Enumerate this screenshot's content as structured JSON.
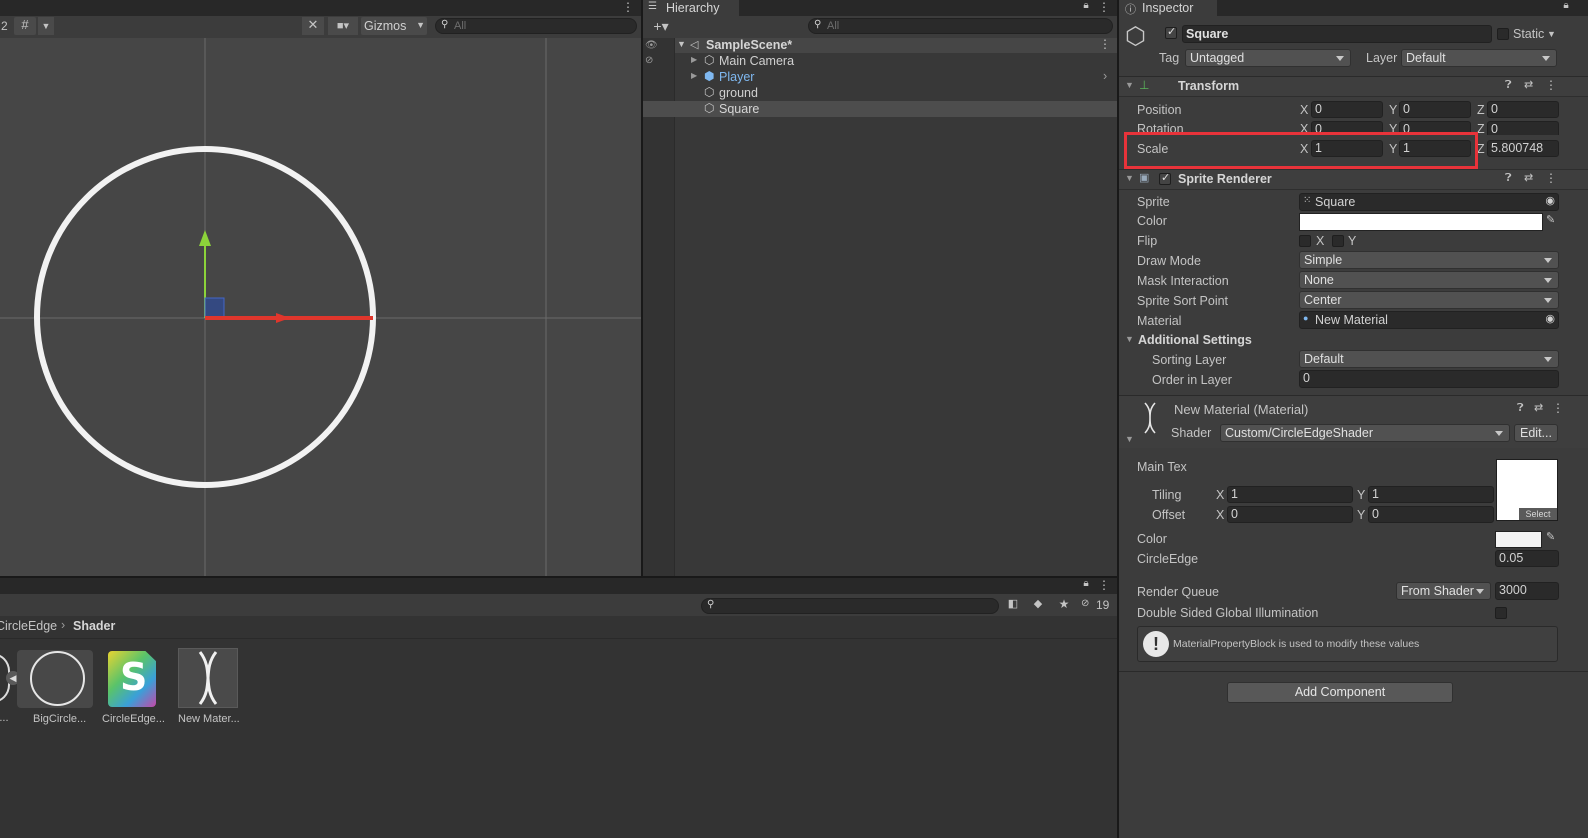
{
  "scene_toolbar": {
    "two_d_label": "2",
    "gizmos_label": "Gizmos",
    "search_placeholder": "All"
  },
  "hierarchy": {
    "tab_label": "Hierarchy",
    "search_placeholder": "All",
    "scene_name": "SampleScene*",
    "items": [
      {
        "label": "Main Camera"
      },
      {
        "label": "Player"
      },
      {
        "label": "ground"
      },
      {
        "label": "Square"
      }
    ]
  },
  "project": {
    "breadcrumb": [
      "CircleEdge",
      "Shader"
    ],
    "hidden_count": "19",
    "assets": [
      {
        "label": "E..."
      },
      {
        "label": "BigCircle..."
      },
      {
        "label": "CircleEdge..."
      },
      {
        "label": "New Mater..."
      }
    ]
  },
  "inspector": {
    "tab_label": "Inspector",
    "object_name": "Square",
    "static_label": "Static",
    "tag_label": "Tag",
    "tag_value": "Untagged",
    "layer_label": "Layer",
    "layer_value": "Default",
    "transform": {
      "title": "Transform",
      "position_label": "Position",
      "rotation_label": "Rotation",
      "scale_label": "Scale",
      "axis_x": "X",
      "axis_y": "Y",
      "axis_z": "Z",
      "position": [
        "0",
        "0",
        "0"
      ],
      "rotation": [
        "0",
        "0",
        "0"
      ],
      "scale": [
        "1",
        "1",
        "5.800748"
      ]
    },
    "sprite_renderer": {
      "title": "Sprite Renderer",
      "sprite_label": "Sprite",
      "sprite_value": "Square",
      "color_label": "Color",
      "flip_label": "Flip",
      "flip_x": "X",
      "flip_y": "Y",
      "draw_mode_label": "Draw Mode",
      "draw_mode_value": "Simple",
      "mask_label": "Mask Interaction",
      "mask_value": "None",
      "sort_point_label": "Sprite Sort Point",
      "sort_point_value": "Center",
      "material_label": "Material",
      "material_value": "New Material",
      "additional_label": "Additional Settings",
      "sorting_layer_label": "Sorting Layer",
      "sorting_layer_value": "Default",
      "order_label": "Order in Layer",
      "order_value": "0"
    },
    "material": {
      "title": "New Material (Material)",
      "shader_label": "Shader",
      "shader_value": "Custom/CircleEdgeShader",
      "edit_label": "Edit...",
      "main_tex_label": "Main Tex",
      "tiling_label": "Tiling",
      "tiling_x": "1",
      "tiling_y": "1",
      "offset_label": "Offset",
      "offset_x": "0",
      "offset_y": "0",
      "select_label": "Select",
      "color_label": "Color",
      "circle_edge_label": "CircleEdge",
      "circle_edge_value": "0.05",
      "render_queue_label": "Render Queue",
      "render_queue_mode": "From Shader",
      "render_queue_value": "3000",
      "dsgi_label": "Double Sided Global Illumination",
      "info_text": "MaterialPropertyBlock is used to modify these values"
    },
    "add_component_label": "Add Component"
  },
  "colors": {
    "accent_red": "#e8333a",
    "gizmo_x": "#e0362c",
    "gizmo_y": "#8cd33a",
    "player_blue": "#7fb8f0"
  }
}
